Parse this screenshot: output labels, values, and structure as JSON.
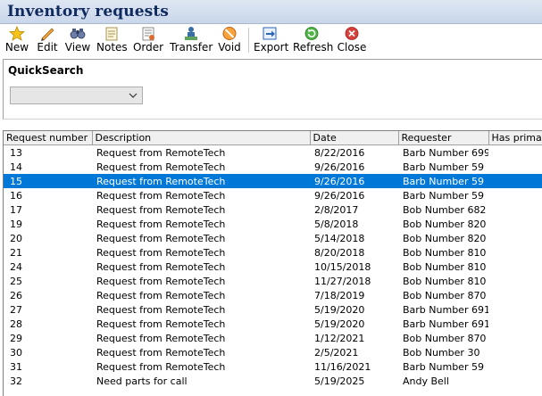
{
  "window": {
    "title": "Inventory requests"
  },
  "toolbar": {
    "new": {
      "label": "New",
      "icon": "star-icon"
    },
    "edit": {
      "label": "Edit",
      "icon": "pencil-icon"
    },
    "view": {
      "label": "View",
      "icon": "binoculars-icon"
    },
    "notes": {
      "label": "Notes",
      "icon": "notes-icon"
    },
    "order": {
      "label": "Order",
      "icon": "order-icon"
    },
    "transfer": {
      "label": "Transfer",
      "icon": "transfer-icon"
    },
    "void": {
      "label": "Void",
      "icon": "void-icon"
    },
    "export": {
      "label": "Export",
      "icon": "export-icon"
    },
    "refresh": {
      "label": "Refresh",
      "icon": "refresh-icon"
    },
    "close": {
      "label": "Close",
      "icon": "close-icon"
    }
  },
  "quicksearch": {
    "label": "QuickSearch",
    "selected": ""
  },
  "grid": {
    "columns": [
      "Request number",
      "Description",
      "Date",
      "Requester",
      "Has primary"
    ],
    "selected_index": 2,
    "rows": [
      [
        "13",
        "Request from RemoteTech",
        "8/22/2016",
        "Barb Number 699",
        ""
      ],
      [
        "14",
        "Request from RemoteTech",
        "9/26/2016",
        "Barb Number 59",
        ""
      ],
      [
        "15",
        "Request from RemoteTech",
        "9/26/2016",
        "Barb Number 59",
        ""
      ],
      [
        "16",
        "Request from RemoteTech",
        "9/26/2016",
        "Barb Number 59",
        ""
      ],
      [
        "17",
        "Request from RemoteTech",
        "2/8/2017",
        "Bob Number 682",
        ""
      ],
      [
        "19",
        "Request from RemoteTech",
        "5/8/2018",
        "Bob Number 820",
        ""
      ],
      [
        "20",
        "Request from RemoteTech",
        "5/14/2018",
        "Bob Number 820",
        ""
      ],
      [
        "21",
        "Request from RemoteTech",
        "8/20/2018",
        "Bob Number 810",
        ""
      ],
      [
        "24",
        "Request from RemoteTech",
        "10/15/2018",
        "Bob Number 810",
        ""
      ],
      [
        "25",
        "Request from RemoteTech",
        "11/27/2018",
        "Bob Number 810",
        ""
      ],
      [
        "26",
        "Request from RemoteTech",
        "7/18/2019",
        "Bob Number 870",
        ""
      ],
      [
        "27",
        "Request from RemoteTech",
        "5/19/2020",
        "Barb Number 691",
        ""
      ],
      [
        "28",
        "Request from RemoteTech",
        "5/19/2020",
        "Barb Number 691",
        ""
      ],
      [
        "29",
        "Request from RemoteTech",
        "1/12/2021",
        "Bob Number 870",
        ""
      ],
      [
        "30",
        "Request from RemoteTech",
        "2/5/2021",
        "Bob Number 30",
        ""
      ],
      [
        "31",
        "Request from RemoteTech",
        "11/16/2021",
        "Barb Number 59",
        ""
      ],
      [
        "32",
        "Need parts for call",
        "5/19/2025",
        "Andy Bell",
        ""
      ]
    ]
  },
  "colors": {
    "selection": "#0078d7",
    "title_text": "#0f2a5e"
  }
}
